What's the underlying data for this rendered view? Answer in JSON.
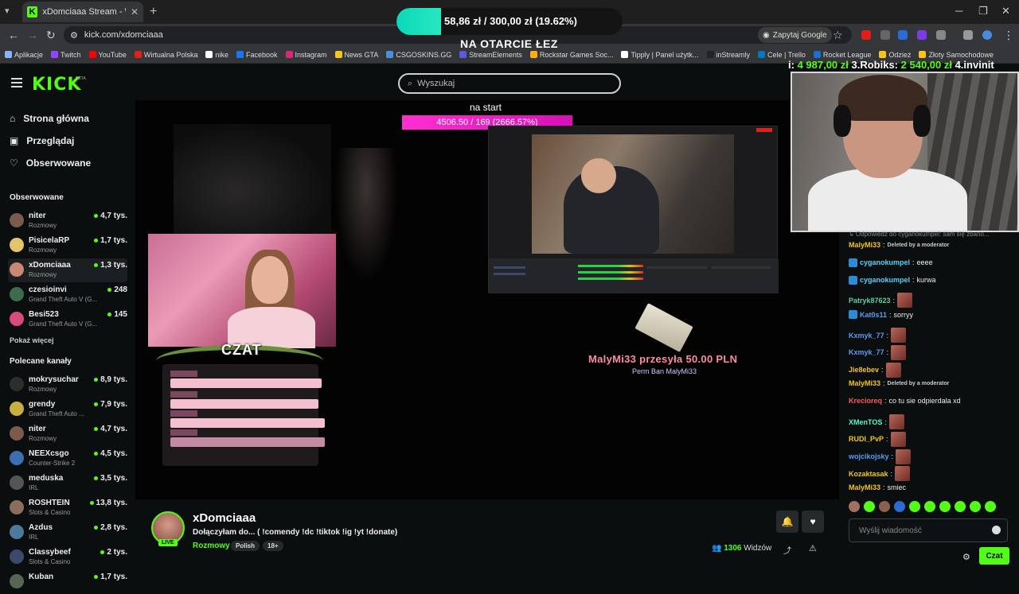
{
  "browser": {
    "tab_title": "xDomciaaa Stream - Watch",
    "url": "kick.com/xdomciaaa",
    "google_button": "Zapytaj Google",
    "bookmarks": [
      {
        "label": "Aplikacje",
        "color": "#8ab4f8"
      },
      {
        "label": "Twitch",
        "color": "#9146ff"
      },
      {
        "label": "YouTube",
        "color": "#ff0000"
      },
      {
        "label": "Wirtualna Polska",
        "color": "#e0211a"
      },
      {
        "label": "nike",
        "color": "#ffffff"
      },
      {
        "label": "Facebook",
        "color": "#1877f2"
      },
      {
        "label": "Instagram",
        "color": "#d62976"
      },
      {
        "label": "News GTA",
        "color": "#f5c518"
      },
      {
        "label": "CSGOSKINS.GG",
        "color": "#4a90e2"
      },
      {
        "label": "StreamElements",
        "color": "#5a5ade"
      },
      {
        "label": "Rockstar Games Soc...",
        "color": "#fcaf17"
      },
      {
        "label": "Tipply | Panel użytk...",
        "color": "#ffffff"
      },
      {
        "label": "inStreamly",
        "color": "#222222"
      },
      {
        "label": "Cele | Trello",
        "color": "#0079bf"
      },
      {
        "label": "Rocket League",
        "color": "#1b6fd1"
      },
      {
        "label": "Odzież",
        "color": "#f5c518"
      },
      {
        "label": "Złoty Samochodowe",
        "color": "#f5c518"
      }
    ]
  },
  "goal_overlay": {
    "text": "58,86 zł  /  300,00 zł (19.62%)",
    "progress": 0.1962,
    "title": "NA OTARCIE ŁEZ"
  },
  "header": {
    "logo": "KICK",
    "beta": "BETA",
    "search_placeholder": "Wyszukaj"
  },
  "sidebar": {
    "nav": [
      {
        "label": "Strona główna",
        "icon": "home-icon"
      },
      {
        "label": "Przeglądaj",
        "icon": "browse-icon"
      },
      {
        "label": "Obserwowane",
        "icon": "heart-icon"
      }
    ],
    "followed_label": "Obserwowane",
    "followed": [
      {
        "name": "niter",
        "category": "Rozmowy",
        "viewers": "4,7 tys.",
        "color": "#7a5b4c"
      },
      {
        "name": "PisicelaRP",
        "category": "Rozmowy",
        "viewers": "1,7 tys.",
        "color": "#e3c46b"
      },
      {
        "name": "xDomciaaa",
        "category": "Rozmowy",
        "viewers": "1,3 tys.",
        "color": "#c98873"
      },
      {
        "name": "czesioinvi",
        "category": "Grand Theft Auto V (G...",
        "viewers": "248",
        "color": "#3e6b4e"
      },
      {
        "name": "Besi523",
        "category": "Grand Theft Auto V (G...",
        "viewers": "145",
        "color": "#d84b7a"
      }
    ],
    "show_more": "Pokaż więcej",
    "recommended_label": "Polecane kanały",
    "recommended": [
      {
        "name": "mokrysuchar",
        "category": "Rozmowy",
        "viewers": "8,9 tys.",
        "color": "#2d2d2d"
      },
      {
        "name": "grendy",
        "category": "Grand Theft Auto ...",
        "viewers": "7,9 tys.",
        "color": "#c8b040"
      },
      {
        "name": "niter",
        "category": "Rozmowy",
        "viewers": "4,7 tys.",
        "color": "#7a5b4c"
      },
      {
        "name": "NEEXcsgo",
        "category": "Counter-Strike 2",
        "viewers": "4,5 tys.",
        "color": "#3d6fb0"
      },
      {
        "name": "meduska",
        "category": "IRL",
        "viewers": "3,5 tys.",
        "color": "#555555"
      },
      {
        "name": "ROSHTEIN",
        "category": "Slots & Casino",
        "viewers": "13,8 tys.",
        "color": "#8a6d5a"
      },
      {
        "name": "Azdus",
        "category": "IRL",
        "viewers": "2,8 tys.",
        "color": "#4d7a9c"
      },
      {
        "name": "Classybeef",
        "category": "Slots & Casino",
        "viewers": "2 tys.",
        "color": "#3a4a6b"
      },
      {
        "name": "Kuban",
        "category": "",
        "viewers": "1,7 tys.",
        "color": "#556655"
      }
    ]
  },
  "video": {
    "czat_title": "CZAT",
    "goal2_label": "na start",
    "goal2_text": "4506.50 / 169 (2666.57%)",
    "donation_text": "MalyMi33  przesyła  50.00  PLN",
    "donation_msg": "Perm Ban MalyMi33"
  },
  "ticker": {
    "parts": [
      "i: ",
      "4 987,00 zł",
      " 3.Robiks: ",
      "2 540,00 zł",
      " 4.invinit"
    ]
  },
  "chat": {
    "reply_preview": "↳ Odpowiedz do cyganokumpel: sam się zbano...",
    "messages": [
      {
        "user": "MalyMi33",
        "color": "#f5c518",
        "text": "Deleted by a moderator",
        "deleted": true,
        "badge": false,
        "emote": false
      },
      {
        "user": "cyganokumpel",
        "color": "#5ad1f7",
        "text": "eeee",
        "deleted": false,
        "badge": true,
        "emote": false
      },
      {
        "user": "cyganokumpel",
        "color": "#5ad1f7",
        "text": "kurwa",
        "deleted": false,
        "badge": true,
        "emote": false
      },
      {
        "user": "Patryk87623",
        "color": "#5ad1a4",
        "text": "",
        "deleted": false,
        "badge": false,
        "emote": true
      },
      {
        "user": "Kat0s11",
        "color": "#5a9cf7",
        "text": "sorryy",
        "deleted": false,
        "badge": true,
        "emote": false
      },
      {
        "user": "Kxmyk_77",
        "color": "#5a9cf7",
        "text": "",
        "deleted": false,
        "badge": false,
        "emote": true
      },
      {
        "user": "Kxmyk_77",
        "color": "#5a9cf7",
        "text": "",
        "deleted": false,
        "badge": false,
        "emote": true
      },
      {
        "user": "Jie8ebev",
        "color": "#f5c518",
        "text": "",
        "deleted": false,
        "badge": false,
        "emote": true
      },
      {
        "user": "MalyMi33",
        "color": "#f5c518",
        "text": "Deleted by a moderator",
        "deleted": true,
        "badge": false,
        "emote": false
      },
      {
        "user": "Krecioreq",
        "color": "#ff5a5a",
        "text": "co tu sie odpierdala xd",
        "deleted": false,
        "badge": false,
        "emote": false
      },
      {
        "user": "XMenTOS",
        "color": "#5af7c8",
        "text": "",
        "deleted": false,
        "badge": false,
        "emote": true
      },
      {
        "user": "RUDI_PvP",
        "color": "#f5c518",
        "text": "",
        "deleted": false,
        "badge": false,
        "emote": true
      },
      {
        "user": "wojcikojsky",
        "color": "#5a9cf7",
        "text": "",
        "deleted": false,
        "badge": false,
        "emote": true
      },
      {
        "user": "Kozaktasak",
        "color": "#f5c518",
        "text": "",
        "deleted": false,
        "badge": false,
        "emote": true
      },
      {
        "user": "MalyMi33",
        "color": "#f5c518",
        "text": "smiec",
        "deleted": false,
        "badge": false,
        "emote": false
      }
    ],
    "input_placeholder": "Wyślij wiadomość",
    "send_label": "Czat"
  },
  "stream": {
    "name": "xDomciaaa",
    "title": "Dołączyłam do...  ( !comendy !dc !tiktok !ig !yt !donate)",
    "category": "Rozmowy",
    "tags": [
      "Polish",
      "18+"
    ],
    "live_label": "LIVE",
    "viewers_count": "1306",
    "viewers_label": "Widzów"
  }
}
